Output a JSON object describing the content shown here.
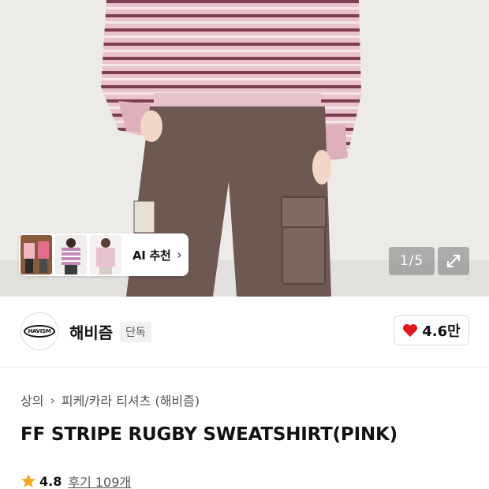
{
  "hero": {
    "ai_recommend_label": "AI 추천",
    "ai_chevron": "›",
    "pager_text": "1/5",
    "expand_icon": "expand-arrows-icon"
  },
  "brand": {
    "logo_text": "HAVISM",
    "name": "해비즘",
    "badge": "단독",
    "like_count": "4.6만",
    "like_icon_color": "#e0191f"
  },
  "product": {
    "breadcrumb": [
      "상의",
      "피케/카라 티셔츠 (해비즘)"
    ],
    "breadcrumb_separator": "›",
    "title": "FF STRIPE RUGBY SWEATSHIRT(PINK)",
    "rating": "4.8",
    "review_text": "후기 109개",
    "star_color": "#f6a623"
  }
}
